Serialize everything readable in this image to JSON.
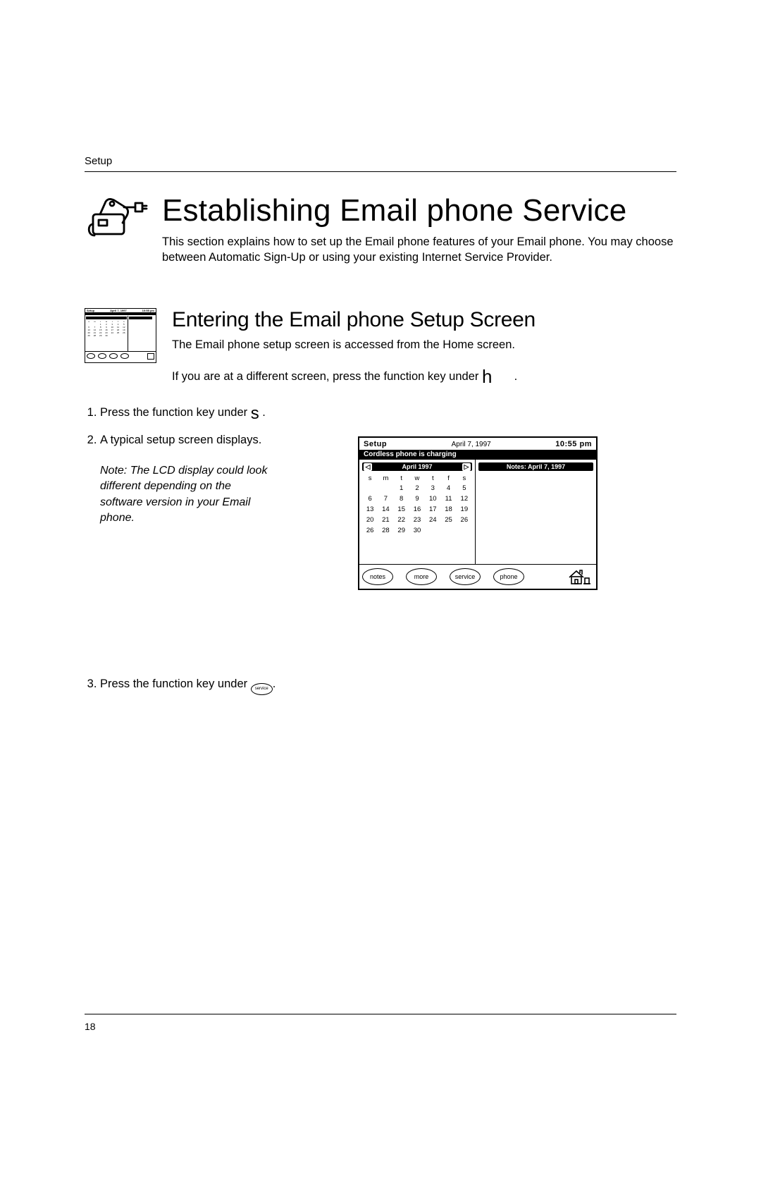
{
  "running_head": "Setup",
  "page_number": "18",
  "main_title": "Establishing Email phone Service",
  "intro": "This section explains how to set up the Email phone features of your Email phone. You may choose between Automatic Sign-Up or using your existing Internet Service Provider.",
  "sub_title": "Entering the Email phone Setup Screen",
  "access_line": "The Email phone setup screen is accessed from the Home screen.",
  "diff_screen_line_pre": "If you are at a different screen, press the function key under ",
  "diff_screen_line_post": ".",
  "home_glyph": "h",
  "step1_pre": "Press the function key under ",
  "step1_glyph": "s",
  "step1_post": " .",
  "step2": "A typical setup screen  displays.",
  "note_text": "Note: The LCD display could look different depending on the software version in your Email phone.",
  "step3_pre": "Press the function key under ",
  "step3_btn": "service",
  "step3_post": ".",
  "lcd": {
    "setup_label": "Setup",
    "date": "April 7, 1997",
    "time": "10:55 pm",
    "status": "Cordless phone is charging",
    "month_label": "April 1997",
    "notes_label": "Notes: April 7, 1997",
    "dow": [
      "s",
      "m",
      "t",
      "w",
      "t",
      "f",
      "s"
    ],
    "weeks": [
      [
        "",
        "",
        "1",
        "2",
        "3",
        "4",
        "5"
      ],
      [
        "6",
        "7",
        "8",
        "9",
        "10",
        "11",
        "12"
      ],
      [
        "13",
        "14",
        "15",
        "16",
        "17",
        "18",
        "19"
      ],
      [
        "20",
        "21",
        "22",
        "23",
        "24",
        "25",
        "26"
      ],
      [
        "26",
        "28",
        "29",
        "30",
        "",
        "",
        ""
      ]
    ],
    "buttons": [
      "notes",
      "more",
      "service",
      "phone"
    ]
  }
}
